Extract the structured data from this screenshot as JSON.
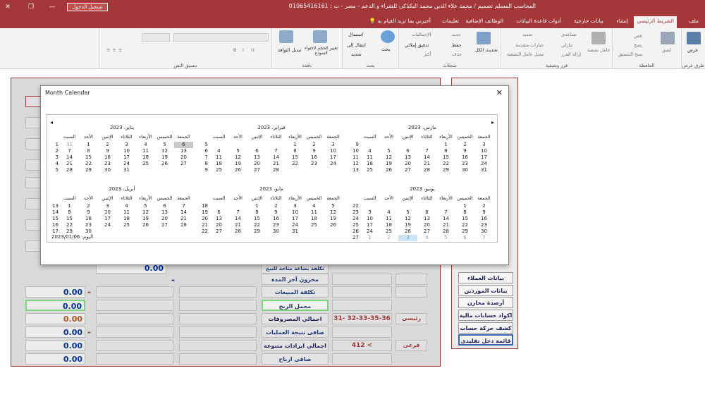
{
  "window": {
    "title": "المحاسب المسلم تصميم / محمد علاء الدين محمد البكباكى للشراء و الدعم - مصر - ت : 01065416161",
    "login_button": "تسجيل الدخول",
    "tell_me": "أخبرني بما تريد القيام به"
  },
  "tabs": [
    "ملف",
    "الشريط الرئيسي",
    "إنشاء",
    "بيانات خارجية",
    "أدوات قاعدة البيانات",
    "الوظائف الإضافية",
    "تعليمات"
  ],
  "ribbon": {
    "groups": [
      "طرق عرض",
      "الحافظة",
      "فرز وتصفية",
      "سجلات",
      "بحث",
      "نافذة",
      "تنسيق النص"
    ],
    "items": {
      "view": "عرض",
      "paste": "لصق",
      "cut": "قص",
      "copy": "نسخ",
      "format_painter": "نسخ التنسيق",
      "filter": "عامل تصفية",
      "asc": "تصاعدي",
      "desc": "تنازلي",
      "remove_sort": "إزالة الفرز",
      "selection": "تحديد",
      "advanced": "خيارات متقدمة",
      "toggle_filter": "تبديل عامل التصفية",
      "refresh_all": "تحديث الكل",
      "new": "جديد",
      "save": "حفظ",
      "delete": "حذف",
      "totals": "الإجماليات",
      "spelling": "تدقيق إملائي",
      "more": "أكثر",
      "find": "بحث",
      "replace": "استبدال",
      "goto": "انتقال إلى",
      "select": "تحديد",
      "size_to_fit": "تغيير الحجم لاحتواء النموذج",
      "switch_windows": "تبديل النوافذ"
    }
  },
  "form": {
    "values": [
      "0.00",
      "0.00",
      "0.00",
      "0.00",
      "0.00",
      "0.00",
      "0.00"
    ],
    "dash": "-",
    "labels": [
      "تكلفة بضاعة متاحة للبيع",
      "مخزون آخر المدة",
      "تكلفة المبيعات",
      "مجمل الربح",
      "اجمالي المصروفات",
      "صافى نتيجة العمليات",
      "اجمالي ايرادات متنوعة",
      "صافى ارباح"
    ],
    "account_main": "رئيسى",
    "account_main_codes": "31- 32-33-35-36",
    "account_sub": "فرعى",
    "account_sub_codes": "412 <"
  },
  "nav": {
    "buttons": [
      "بيانات العملاء",
      "بيانات الموردين",
      "أرصدة مخازن",
      "اكواد حسابات مالية",
      "كشف حركة حساب",
      "قائمة دخل تقليدى"
    ]
  },
  "calendar": {
    "title": "Month Calendar",
    "close": "✕",
    "today_label": "اليوم: 2023/01/06",
    "dow": [
      "السبت",
      "الأحد",
      "الإثنين",
      "الثلاثاء",
      "الأربعاء",
      "الخميس",
      "الجمعة"
    ],
    "months": [
      {
        "name": "يناير، 2023",
        "weeks": [
          [
            "1",
            "31",
            "1",
            "2",
            "3",
            "4",
            "5",
            "6"
          ],
          [
            "2",
            "7",
            "8",
            "9",
            "10",
            "11",
            "12",
            "13"
          ],
          [
            "3",
            "14",
            "15",
            "16",
            "17",
            "18",
            "19",
            "20"
          ],
          [
            "4",
            "21",
            "22",
            "23",
            "24",
            "25",
            "26",
            "27"
          ],
          [
            "5",
            "28",
            "29",
            "30",
            "31",
            "",
            "",
            ""
          ]
        ]
      },
      {
        "name": "فبراير، 2023",
        "weeks": [
          [
            "5",
            "",
            "",
            "",
            "",
            "1",
            "2",
            "3"
          ],
          [
            "6",
            "4",
            "5",
            "6",
            "7",
            "8",
            "9",
            "10"
          ],
          [
            "7",
            "11",
            "12",
            "13",
            "14",
            "15",
            "16",
            "17"
          ],
          [
            "8",
            "18",
            "19",
            "20",
            "21",
            "22",
            "23",
            "24"
          ],
          [
            "9",
            "25",
            "26",
            "27",
            "28",
            "",
            "",
            ""
          ]
        ]
      },
      {
        "name": "مارس، 2023",
        "weeks": [
          [
            "9",
            "",
            "",
            "",
            "",
            "1",
            "2",
            "3"
          ],
          [
            "10",
            "4",
            "5",
            "6",
            "7",
            "8",
            "9",
            "10"
          ],
          [
            "11",
            "11",
            "12",
            "13",
            "14",
            "15",
            "16",
            "17"
          ],
          [
            "12",
            "18",
            "19",
            "20",
            "21",
            "22",
            "23",
            "24"
          ],
          [
            "13",
            "25",
            "26",
            "27",
            "28",
            "29",
            "30",
            "31"
          ]
        ]
      },
      {
        "name": "أبريل، 2023",
        "weeks": [
          [
            "13",
            "1",
            "2",
            "3",
            "4",
            "5",
            "6",
            "7"
          ],
          [
            "14",
            "8",
            "9",
            "10",
            "11",
            "12",
            "13",
            "14"
          ],
          [
            "15",
            "15",
            "16",
            "17",
            "18",
            "19",
            "20",
            "21"
          ],
          [
            "16",
            "22",
            "23",
            "24",
            "25",
            "26",
            "27",
            "28"
          ],
          [
            "17",
            "29",
            "30",
            "",
            "",
            "",
            "",
            ""
          ]
        ]
      },
      {
        "name": "مايو، 2023",
        "weeks": [
          [
            "18",
            "",
            "",
            "1",
            "2",
            "3",
            "4",
            "5"
          ],
          [
            "19",
            "6",
            "7",
            "8",
            "9",
            "10",
            "11",
            "12"
          ],
          [
            "20",
            "13",
            "14",
            "15",
            "16",
            "17",
            "18",
            "19"
          ],
          [
            "21",
            "20",
            "21",
            "22",
            "23",
            "24",
            "25",
            "26"
          ],
          [
            "22",
            "27",
            "28",
            "29",
            "30",
            "31",
            "",
            ""
          ]
        ]
      },
      {
        "name": "يونيو، 2023",
        "weeks": [
          [
            "22",
            "",
            "",
            "",
            "",
            "",
            "1",
            "2"
          ],
          [
            "23",
            "3",
            "4",
            "5",
            "6",
            "7",
            "8",
            "9"
          ],
          [
            "24",
            "10",
            "11",
            "12",
            "13",
            "14",
            "15",
            "16"
          ],
          [
            "25",
            "17",
            "18",
            "19",
            "20",
            "21",
            "22",
            "23"
          ],
          [
            "26",
            "24",
            "25",
            "26",
            "27",
            "28",
            "29",
            "30"
          ],
          [
            "27",
            "1",
            "2",
            "3",
            "4",
            "5",
            "6",
            "7"
          ]
        ]
      }
    ]
  }
}
